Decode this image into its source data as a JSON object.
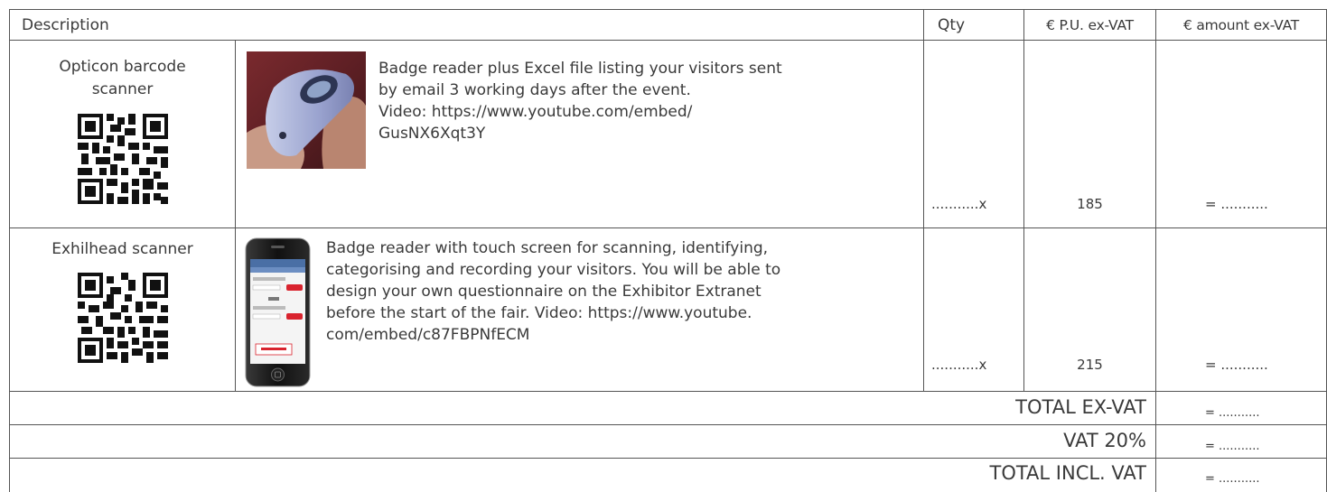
{
  "table": {
    "headers": {
      "description": "Description",
      "qty": "Qty",
      "unit_price": "€ P.U. ex-VAT",
      "amount": "€ amount ex-VAT"
    },
    "rows": [
      {
        "name_line1": "Opticon barcode",
        "name_line2": "scanner",
        "description_lines": [
          "Badge reader plus Excel file listing your visitors sent",
          "by email 3 working days after the event.",
          "Video: https://www.youtube.com/embed/",
          "GusNX6Xqt3Y"
        ],
        "qty": "...........x",
        "unit_price": "185",
        "amount": "= ..........."
      },
      {
        "name_line1": "Exhilhead scanner",
        "description_lines": [
          "Badge reader with touch screen for scanning, identifying,",
          "categorising and recording your visitors. You will be able to",
          "design your own questionnaire on the Exhibitor Extranet",
          "before the start of the fair. Video: https://www.youtube.",
          "com/embed/c87FBPNfECM"
        ],
        "qty": "...........x",
        "unit_price": "215",
        "amount": "= ..........."
      }
    ],
    "totals": [
      {
        "label": "TOTAL EX-VAT",
        "value": "= ..........."
      },
      {
        "label": "VAT 20%",
        "value": "= ..........."
      },
      {
        "label": "TOTAL INCL. VAT",
        "value": "= ..........."
      }
    ]
  },
  "icons": {
    "qr_code": "qr-code-icon",
    "scanner_photo": "barcode-scanner-photo",
    "phone_photo": "smartphone-photo"
  },
  "colors": {
    "border": "#555555",
    "text": "#3a3a3a",
    "phone_screen_red": "#d9232e"
  }
}
